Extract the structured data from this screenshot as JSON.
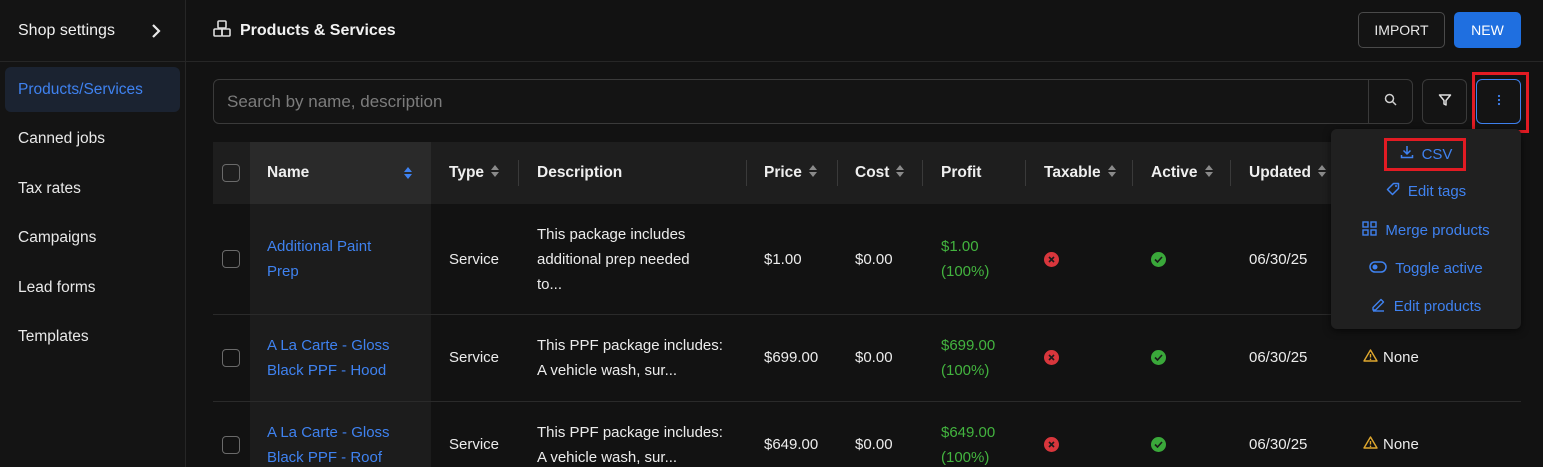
{
  "sidebar": {
    "header": "Shop settings",
    "items": [
      {
        "label": "Products/Services",
        "active": true
      },
      {
        "label": "Canned jobs",
        "active": false
      },
      {
        "label": "Tax rates",
        "active": false
      },
      {
        "label": "Campaigns",
        "active": false
      },
      {
        "label": "Lead forms",
        "active": false
      },
      {
        "label": "Templates",
        "active": false
      }
    ]
  },
  "header": {
    "title": "Products & Services",
    "import_label": "IMPORT",
    "new_label": "NEW"
  },
  "search": {
    "placeholder": "Search by name, description",
    "value": ""
  },
  "table": {
    "columns": [
      "Name",
      "Type",
      "Description",
      "Price",
      "Cost",
      "Profit",
      "Taxable",
      "Active",
      "Updated"
    ],
    "rows": [
      {
        "name_line1": "Additional Paint",
        "name_line2": "Prep",
        "type": "Service",
        "desc_line1": "This package includes",
        "desc_line2": "additional prep needed",
        "desc_line3": "to...",
        "price": "$1.00",
        "cost": "$0.00",
        "profit_line1": "$1.00",
        "profit_line2": "(100%)",
        "taxable": false,
        "active": true,
        "updated": "06/30/25",
        "tag": ""
      },
      {
        "name_line1": "A La Carte - Gloss",
        "name_line2": "Black PPF - Hood",
        "type": "Service",
        "desc_line1": "This PPF package includes:",
        "desc_line2": "A vehicle wash, sur...",
        "desc_line3": "",
        "price": "$699.00",
        "cost": "$0.00",
        "profit_line1": "$699.00",
        "profit_line2": "(100%)",
        "taxable": false,
        "active": true,
        "updated": "06/30/25",
        "tag": "None"
      },
      {
        "name_line1": "A La Carte - Gloss",
        "name_line2": "Black PPF - Roof",
        "type": "Service",
        "desc_line1": "This PPF package includes:",
        "desc_line2": "A vehicle wash, sur...",
        "desc_line3": "",
        "price": "$649.00",
        "cost": "$0.00",
        "profit_line1": "$649.00",
        "profit_line2": "(100%)",
        "taxable": false,
        "active": true,
        "updated": "06/30/25",
        "tag": "None"
      }
    ]
  },
  "menu": {
    "items": [
      {
        "label": "CSV",
        "icon": "download-icon"
      },
      {
        "label": "Edit tags",
        "icon": "tag-icon"
      },
      {
        "label": "Merge products",
        "icon": "merge-icon"
      },
      {
        "label": "Toggle active",
        "icon": "toggle-icon"
      },
      {
        "label": "Edit products",
        "icon": "pencil-icon"
      }
    ]
  },
  "colors": {
    "accent": "#3f82f0",
    "primary_button": "#1f6fe0",
    "profit": "#43b43f",
    "highlight": "#e21b23"
  }
}
